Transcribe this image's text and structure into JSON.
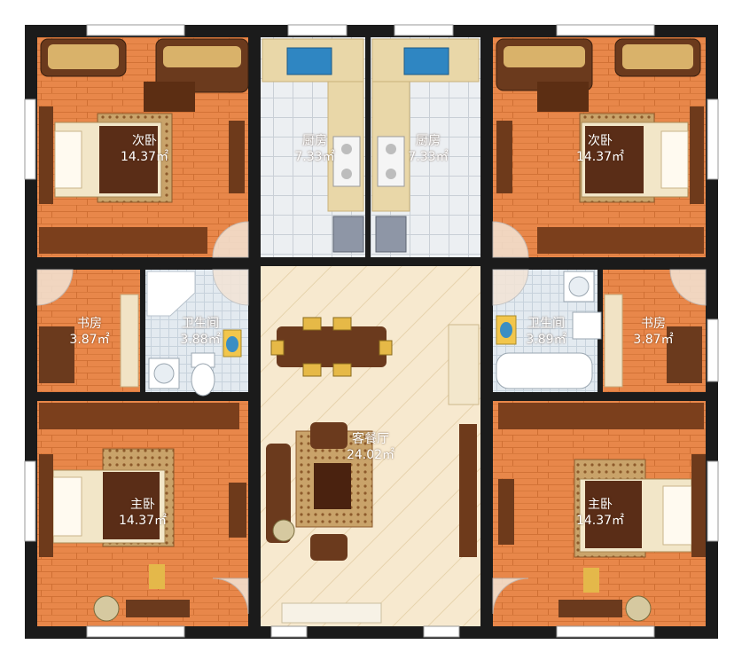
{
  "rooms": {
    "bedroom2_left": {
      "name": "次卧",
      "area": "14.37㎡"
    },
    "bedroom2_right": {
      "name": "次卧",
      "area": "14.37㎡"
    },
    "kitchen_left": {
      "name": "厨房",
      "area": "7.33㎡"
    },
    "kitchen_right": {
      "name": "厨房",
      "area": "7.33㎡"
    },
    "study_left": {
      "name": "书房",
      "area": "3.87㎡"
    },
    "study_right": {
      "name": "书房",
      "area": "3.87㎡"
    },
    "bath_left": {
      "name": "卫生间",
      "area": "3.88㎡"
    },
    "bath_right": {
      "name": "卫生间",
      "area": "3.89㎡"
    },
    "living": {
      "name": "客餐厅",
      "area": "24.02㎡"
    },
    "master_left": {
      "name": "主卧",
      "area": "14.37㎡"
    },
    "master_right": {
      "name": "主卧",
      "area": "14.37㎡"
    }
  },
  "colors": {
    "wall": "#1b1b1b",
    "wood_floor": "#e88a4c",
    "wood_floor_dark": "#d9763a",
    "tile_floor": "#e4e8ec",
    "living_floor": "#f6e7cc",
    "counter": "#e9d7a8",
    "window": "#ffffff"
  }
}
